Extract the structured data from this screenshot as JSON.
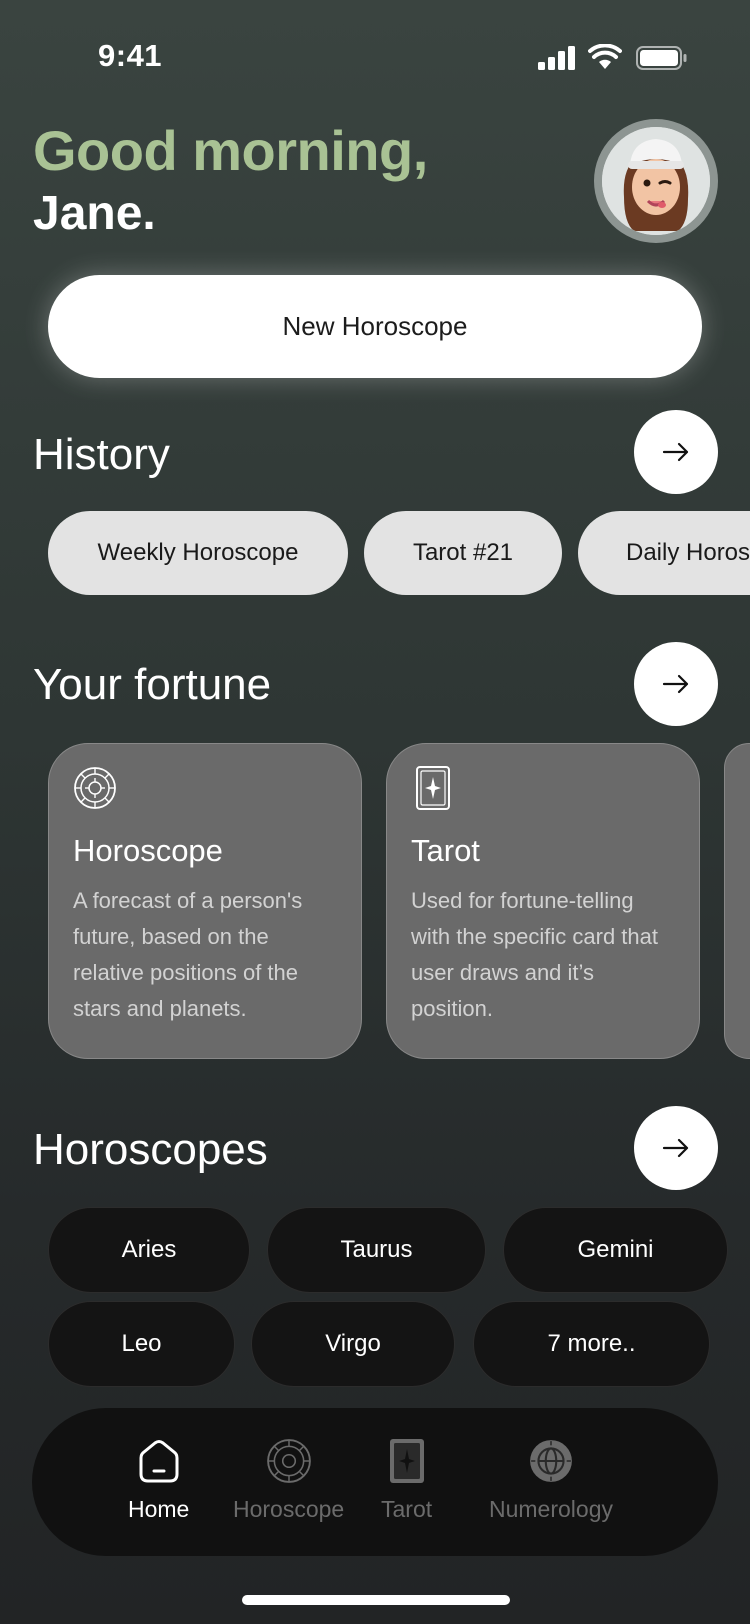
{
  "status_bar": {
    "time": "9:41"
  },
  "header": {
    "greeting": "Good morning,",
    "name": "Jane."
  },
  "primary_button": {
    "label": "New Horoscope"
  },
  "history": {
    "title": "History",
    "items": [
      "Weekly Horoscope",
      "Tarot #21",
      "Daily Horos"
    ]
  },
  "fortune": {
    "title": "Your fortune",
    "cards": [
      {
        "icon": "zodiac-wheel-icon",
        "title": "Horoscope",
        "description": "A forecast of a person's future, based on the relative positions of the stars and planets."
      },
      {
        "icon": "tarot-card-icon",
        "title": "Tarot",
        "description": "Used for fortune-telling with the specific card that user draws and it’s position."
      }
    ]
  },
  "horoscopes": {
    "title": "Horoscopes",
    "signs": [
      "Aries",
      "Taurus",
      "Gemini",
      "Leo",
      "Virgo",
      "7 more.."
    ]
  },
  "tabbar": {
    "tabs": [
      {
        "label": "Home",
        "icon": "home-icon",
        "active": true
      },
      {
        "label": "Horoscope",
        "icon": "zodiac-wheel-icon",
        "active": false
      },
      {
        "label": "Tarot",
        "icon": "tarot-card-icon",
        "active": false
      },
      {
        "label": "Numerology",
        "icon": "globe-icon",
        "active": false
      }
    ]
  },
  "colors": {
    "greeting": "#a9c294",
    "card_bg": "#6a6a6a",
    "sign_bg": "#141414",
    "tabbar_bg": "#111111"
  }
}
